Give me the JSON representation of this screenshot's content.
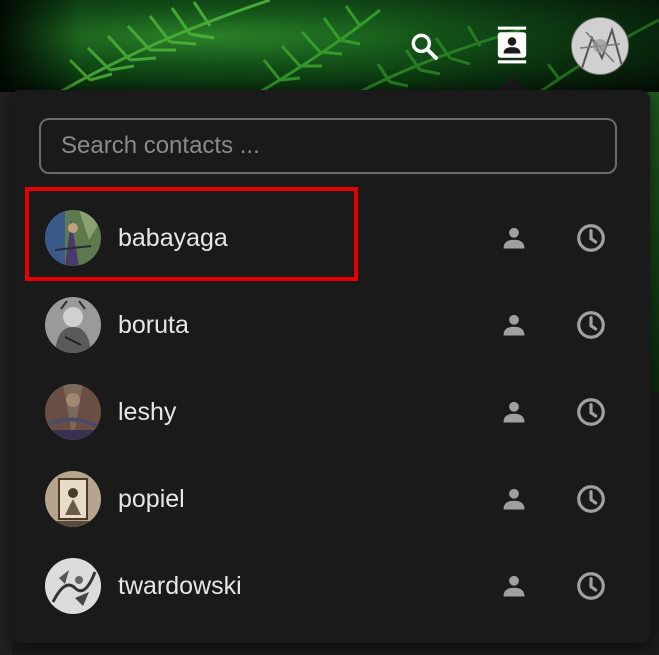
{
  "topbar": {
    "search_icon": "search-icon",
    "contacts_icon": "contacts-icon",
    "avatar": "user-avatar"
  },
  "panel": {
    "search": {
      "placeholder": "Search contacts ...",
      "value": ""
    },
    "contacts": [
      {
        "name": "babayaga",
        "avatar_colors": [
          "#6b8a5a",
          "#4a3a6a",
          "#2a5a9a"
        ],
        "selected": true
      },
      {
        "name": "boruta",
        "avatar_colors": [
          "#c8c8c8",
          "#777777",
          "#333333"
        ],
        "selected": false
      },
      {
        "name": "leshy",
        "avatar_colors": [
          "#8a6a5a",
          "#4a4a6a",
          "#6a5a4a"
        ],
        "selected": false
      },
      {
        "name": "popiel",
        "avatar_colors": [
          "#b8a890",
          "#7a6a5a",
          "#3a2a1a"
        ],
        "selected": false
      },
      {
        "name": "twardowski",
        "avatar_colors": [
          "#d8d8d8",
          "#6a6a6a",
          "#2a2a2a"
        ],
        "selected": false
      }
    ],
    "row_icons": [
      "profile-icon",
      "history-icon"
    ]
  },
  "colors": {
    "highlight": "#e60000",
    "panel_bg": "#1a1a1a",
    "text": "#e6e6e6",
    "icon": "#a0a0a0"
  }
}
